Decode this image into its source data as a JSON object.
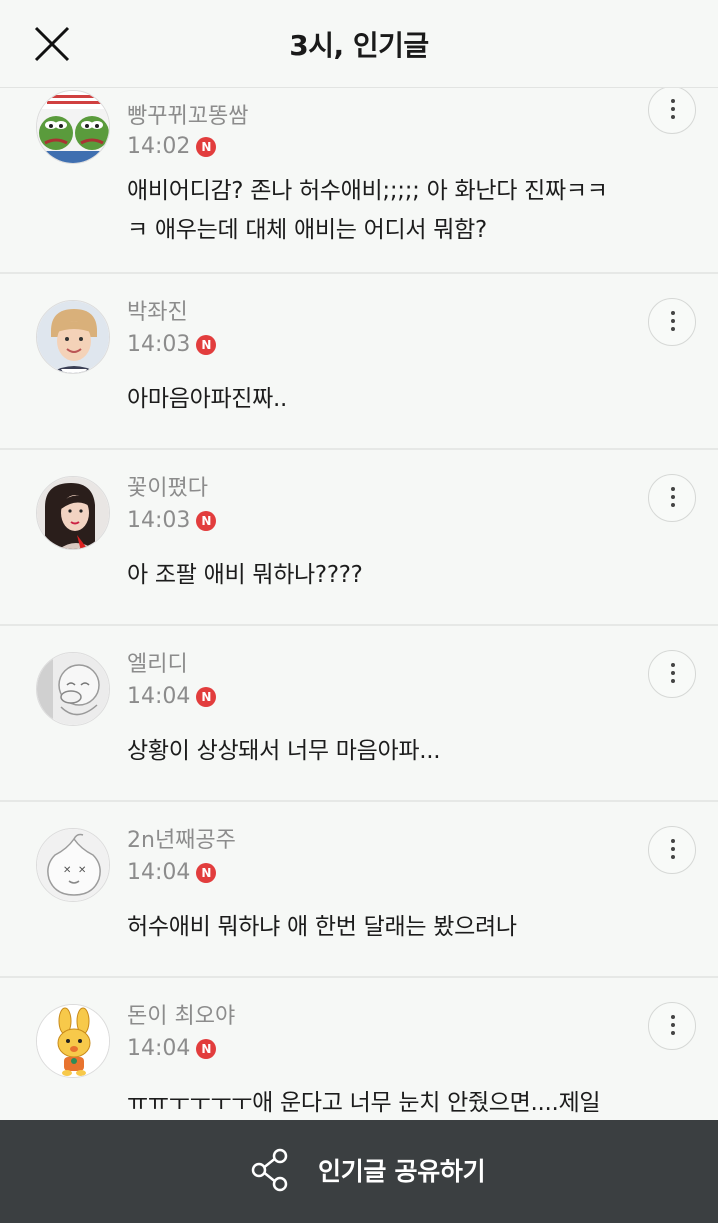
{
  "header": {
    "title": "3시, 인기글"
  },
  "comments": [
    {
      "username": "빵꾸뀌꼬똥쌈",
      "time": "14:02",
      "badge": "N",
      "lines": [
        "애비어디감? 존나 허수애비;;;;; 아 화난다 진짜ㅋㅋ",
        "ㅋ 애우는데 대체 애비는 어디서 뭐함?"
      ],
      "avatar": "frog-meme-avatar"
    },
    {
      "username": "박좌진",
      "time": "14:03",
      "badge": "N",
      "lines": [
        "아마음아파진짜.."
      ],
      "avatar": "person-photo-avatar"
    },
    {
      "username": "꽃이폈다",
      "time": "14:03",
      "badge": "N",
      "lines": [
        "아 조팔 애비 뭐하나????"
      ],
      "avatar": "woman-photo-avatar"
    },
    {
      "username": "엘리디",
      "time": "14:04",
      "badge": "N",
      "lines": [
        "상황이 상상돼서 너무 마음아파..."
      ],
      "avatar": "sketch-character-avatar"
    },
    {
      "username": "2n년째공주",
      "time": "14:04",
      "badge": "N",
      "lines": [
        "허수애비 뭐하냐 애 한번 달래는 봤으려나"
      ],
      "avatar": "peach-character-avatar"
    },
    {
      "username": "돈이 최오야",
      "time": "14:04",
      "badge": "N",
      "lines": [
        "ㅠㅠㅜㅜㅜㅜ애 운다고 너무 눈치 안줬으면....제일"
      ],
      "avatar": "rabbit-character-avatar"
    }
  ],
  "footer": {
    "share_label": "인기글 공유하기"
  },
  "colors": {
    "background": "#f6f8f6",
    "badge": "#e23d3d",
    "bottom_bar": "#3b3f41",
    "meta_text": "#8c8c8c"
  }
}
